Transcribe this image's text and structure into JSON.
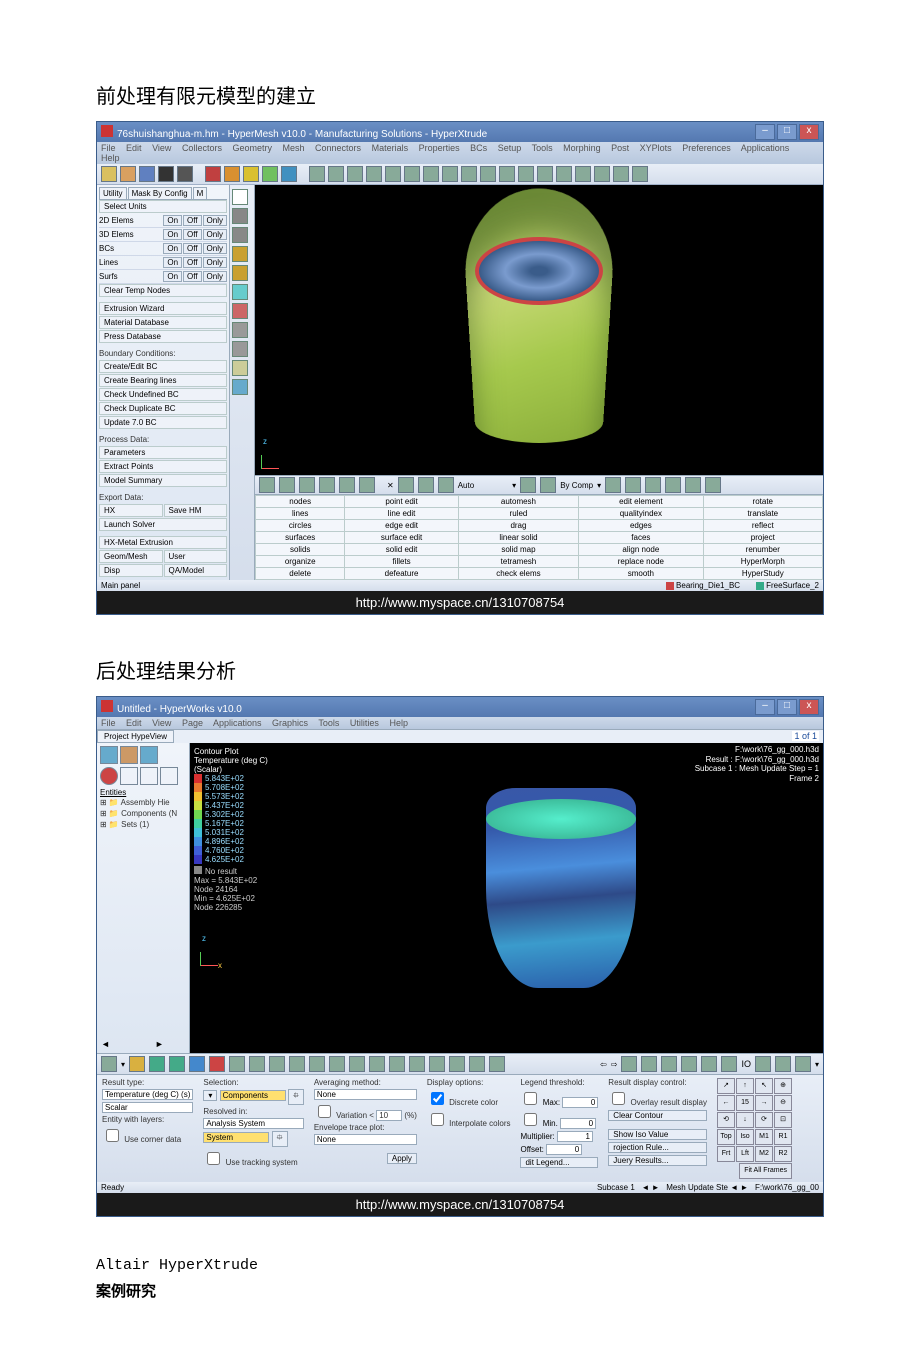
{
  "heading1": "前处理有限元模型的建立",
  "heading2": "后处理结果分析",
  "footer_url": "http://www.myspace.cn/1310708754",
  "hypermesh": {
    "title": "76shuishanghua-m.hm - HyperMesh v10.0 - Manufacturing Solutions - HyperXtrude",
    "menu": [
      "File",
      "Edit",
      "View",
      "Collectors",
      "Geometry",
      "Mesh",
      "Connectors",
      "Materials",
      "Properties",
      "BCs",
      "Setup",
      "Tools",
      "Morphing",
      "Post",
      "XYPlots",
      "Preferences",
      "Applications",
      "Help"
    ],
    "left_tabs": [
      "Utility",
      "Mask By Config",
      "M"
    ],
    "select_units": "Select Units",
    "elem_rows": [
      {
        "label": "2D Elems",
        "b1": "On",
        "b2": "Off",
        "b3": "Only"
      },
      {
        "label": "3D Elems",
        "b1": "On",
        "b2": "Off",
        "b3": "Only"
      },
      {
        "label": "BCs",
        "b1": "On",
        "b2": "Off",
        "b3": "Only"
      },
      {
        "label": "Lines",
        "b1": "On",
        "b2": "Off",
        "b3": "Only"
      },
      {
        "label": "Surfs",
        "b1": "On",
        "b2": "Off",
        "b3": "Only"
      }
    ],
    "clear_temp": "Clear Temp Nodes",
    "wizard_items": [
      "Extrusion Wizard",
      "Material Database",
      "Press Database"
    ],
    "bc_label": "Boundary Conditions:",
    "bc_items": [
      "Create/Edit BC",
      "Create Bearing lines",
      "Check Undefined BC",
      "Check Duplicate BC",
      "Update 7.0 BC"
    ],
    "process_label": "Process Data:",
    "process_items": [
      "Parameters",
      "Extract Points",
      "Model Summary"
    ],
    "export_label": "Export Data:",
    "export_items": [
      [
        "HX",
        "Save HM"
      ],
      [
        "Launch Solver",
        ""
      ]
    ],
    "hx_item": "HX-Metal Extrusion",
    "bottom_tabs": [
      [
        "Geom/Mesh",
        "User"
      ],
      [
        "Disp",
        "QA/Model"
      ]
    ],
    "main_panel": "Main panel",
    "view_toolbar": [
      "Auto",
      "By Comp"
    ],
    "cmd_grid": [
      [
        "nodes",
        "point edit",
        "automesh",
        "edit element",
        "rotate"
      ],
      [
        "lines",
        "line edit",
        "ruled",
        "qualityindex",
        "translate"
      ],
      [
        "circles",
        "edge edit",
        "drag",
        "edges",
        "reflect"
      ],
      [
        "surfaces",
        "surface edit",
        "linear solid",
        "faces",
        "project"
      ],
      [
        "solids",
        "solid edit",
        "solid map",
        "align node",
        "renumber"
      ],
      [
        "organize",
        "fillets",
        "tetramesh",
        "replace node",
        "HyperMorph"
      ],
      [
        "delete",
        "defeature",
        "check elems",
        "smooth",
        "HyperStudy"
      ]
    ],
    "status_right": [
      {
        "color": "#c44",
        "label": "Bearing_Die1_BC"
      },
      {
        "color": "#3a8",
        "label": "FreeSurface_2"
      }
    ]
  },
  "hyperview": {
    "title": "Untitled - HyperWorks v10.0",
    "menu": [
      "File",
      "Edit",
      "View",
      "Page",
      "Applications",
      "Graphics",
      "Tools",
      "Utilities",
      "Help"
    ],
    "project_tab": "Project   HypeView",
    "page_count": "1 of 1",
    "tree_label": "Entities",
    "tree_items": [
      "Assembly Hie",
      "Components (N",
      "Sets  (1)"
    ],
    "legend_title": "Contour Plot",
    "legend_sub": "Temperature (deg C)(Scalar)",
    "legend_vals": [
      {
        "c": "#d93030",
        "v": "5.843E+02"
      },
      {
        "c": "#e87a30",
        "v": "5.708E+02"
      },
      {
        "c": "#f0c030",
        "v": "5.573E+02"
      },
      {
        "c": "#c8e040",
        "v": "5.437E+02"
      },
      {
        "c": "#70d850",
        "v": "5.302E+02"
      },
      {
        "c": "#40d0a0",
        "v": "5.167E+02"
      },
      {
        "c": "#40c0d8",
        "v": "5.031E+02"
      },
      {
        "c": "#4090e0",
        "v": "4.896E+02"
      },
      {
        "c": "#4060d8",
        "v": "4.760E+02"
      },
      {
        "c": "#3838c0",
        "v": "4.625E+02"
      }
    ],
    "legend_notes": [
      "No result",
      "Max = 5.843E+02",
      "Node 24164",
      "Min = 4.625E+02",
      "Node 226285"
    ],
    "info": [
      "F:\\work\\76_gg_000.h3d",
      "Result : F:\\work\\76_gg_000.h3d",
      "Subcase 1 : Mesh Update Step = 1",
      "Frame 2"
    ],
    "panel": {
      "result_type_label": "Result type:",
      "result_type": "Temperature (deg C) (s)",
      "scalar": "Scalar",
      "entity_label": "Entity with layers:",
      "corner": "Use corner data",
      "selection_label": "Selection:",
      "components": "Components",
      "resolved_label": "Resolved in:",
      "analysis_system": "Analysis System",
      "system": "System",
      "none": "None",
      "tracking": "Use tracking system",
      "avg_label": "Averaging method:",
      "variation": "Variation <",
      "variation_val": "10",
      "variation_unit": "(%)",
      "envelope": "Envelope trace plot:",
      "apply": "Apply",
      "display_label": "Display options:",
      "discrete": "Discrete color",
      "interpolate": "Interpolate colors",
      "legend_label": "Legend threshold:",
      "max": "Max:",
      "max_val": "0",
      "min": "Min.",
      "min_val": "0",
      "mult": "Multiplier:",
      "mult_val": "1",
      "offset": "Offset:",
      "offset_val": "0",
      "edit_legend": "dit Legend...",
      "result_display": "Result display control:",
      "overlay": "Overlay result display",
      "clear": "Clear Contour",
      "show_iso": "Show Iso Value",
      "projection": "rojection Rule...",
      "query": "Juery Results...",
      "fit_all": "Fit All Frames",
      "iconcol": [
        [
          "Top",
          "Iso",
          "M1",
          "R1"
        ],
        [
          "Frt",
          "Lft",
          "M2",
          "R2"
        ]
      ],
      "spin": "15"
    },
    "status": {
      "left": "Ready",
      "mid": "Subcase 1",
      "right": "Mesh Update Ste",
      "path": "F:\\work\\76_gg_00"
    }
  },
  "bottom": {
    "line1": "Altair HyperXtrude",
    "line2": "案例研究"
  }
}
